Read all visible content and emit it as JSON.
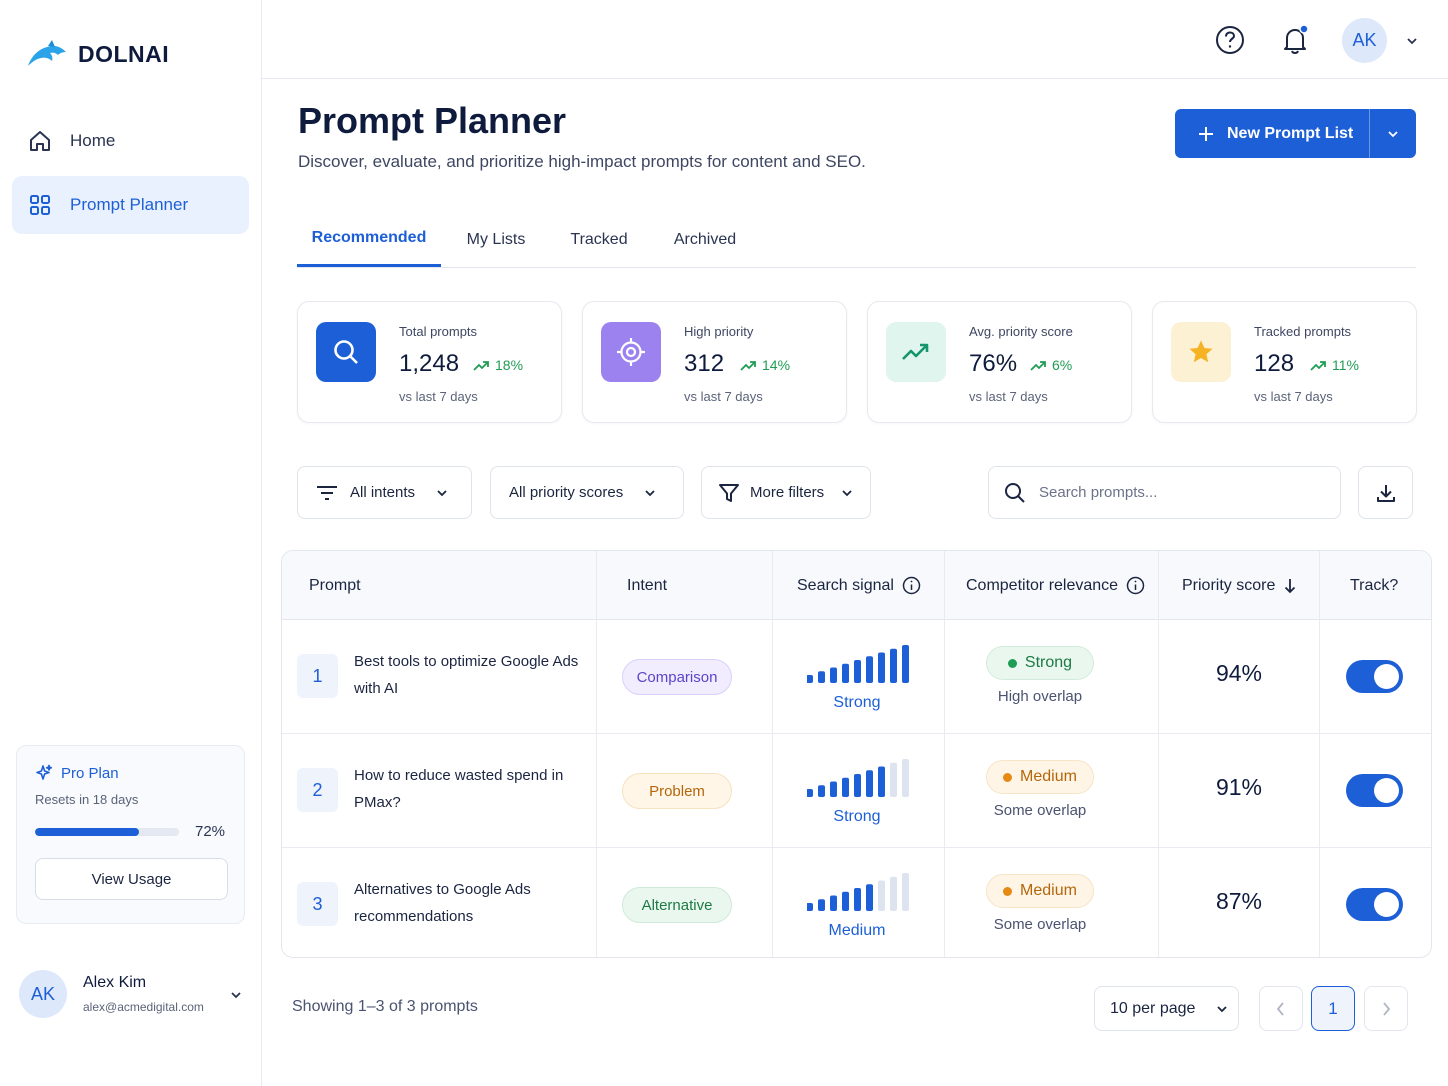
{
  "app": {
    "name": "DOLNAI"
  },
  "sidebar": {
    "items": [
      {
        "label": "Home",
        "icon": "home-icon",
        "active": false
      },
      {
        "label": "Prompt Planner",
        "icon": "grid-icon",
        "active": true
      }
    ],
    "plan": {
      "name": "Pro Plan",
      "resets": "Resets in 18 days",
      "usage_fraction": 0.72,
      "usage_label": "72%",
      "button": "View Usage"
    },
    "user": {
      "initials": "AK",
      "name": "Alex Kim",
      "email": "alex@acmedigital.com"
    }
  },
  "topbar": {
    "avatar_initials": "AK",
    "notification_dot": true
  },
  "page": {
    "title": "Prompt Planner",
    "subtitle": "Discover, evaluate, and prioritize high-impact prompts for content and SEO.",
    "new_button": "New Prompt List"
  },
  "tabs": [
    {
      "label": "Recommended",
      "active": true
    },
    {
      "label": "My Lists",
      "active": false
    },
    {
      "label": "Tracked",
      "active": false
    },
    {
      "label": "Archived",
      "active": false
    }
  ],
  "stats": [
    {
      "label": "Total prompts",
      "value": "1,248",
      "delta": "18%",
      "foot": "vs last 7 days",
      "icon": "search-icon",
      "color": "#1d5fd6"
    },
    {
      "label": "High priority",
      "value": "312",
      "delta": "14%",
      "foot": "vs last 7 days",
      "icon": "target-icon",
      "color": "#9b82ef"
    },
    {
      "label": "Avg. priority score",
      "value": "76%",
      "delta": "6%",
      "foot": "vs last 7 days",
      "icon": "trend-up-icon",
      "color": "#dff5ee"
    },
    {
      "label": "Tracked prompts",
      "value": "128",
      "delta": "11%",
      "foot": "vs last 7 days",
      "icon": "star-icon",
      "color": "#fdf1d4"
    }
  ],
  "filters": {
    "intent": "All intents",
    "priority": "All priority scores",
    "more": "More filters",
    "search_placeholder": "Search prompts..."
  },
  "table": {
    "columns": [
      "Prompt",
      "Intent",
      "Search signal",
      "Competitor relevance",
      "Priority score",
      "Track?"
    ],
    "rows": [
      {
        "num": "1",
        "prompt": "Best tools to optimize Google Ads with AI",
        "intent": "Comparison",
        "intent_style": "comparison",
        "signal_level": 9,
        "signal": "Strong",
        "relevance": "Strong",
        "relevance_style": "strong",
        "overlap": "High overlap",
        "score": "94%",
        "tracked": true
      },
      {
        "num": "2",
        "prompt": "How to reduce wasted spend in PMax?",
        "intent": "Problem",
        "intent_style": "problem",
        "signal_level": 7,
        "signal": "Strong",
        "relevance": "Medium",
        "relevance_style": "medium",
        "overlap": "Some overlap",
        "score": "91%",
        "tracked": true
      },
      {
        "num": "3",
        "prompt": "Alternatives to Google Ads recommendations",
        "intent": "Alternative",
        "intent_style": "alternative",
        "signal_level": 6,
        "signal": "Medium",
        "relevance": "Medium",
        "relevance_style": "medium",
        "overlap": "Some overlap",
        "score": "87%",
        "tracked": true
      }
    ]
  },
  "footer": {
    "showing": "Showing 1–3 of 3 prompts",
    "per_page": "10 per page",
    "current_page": "1"
  }
}
